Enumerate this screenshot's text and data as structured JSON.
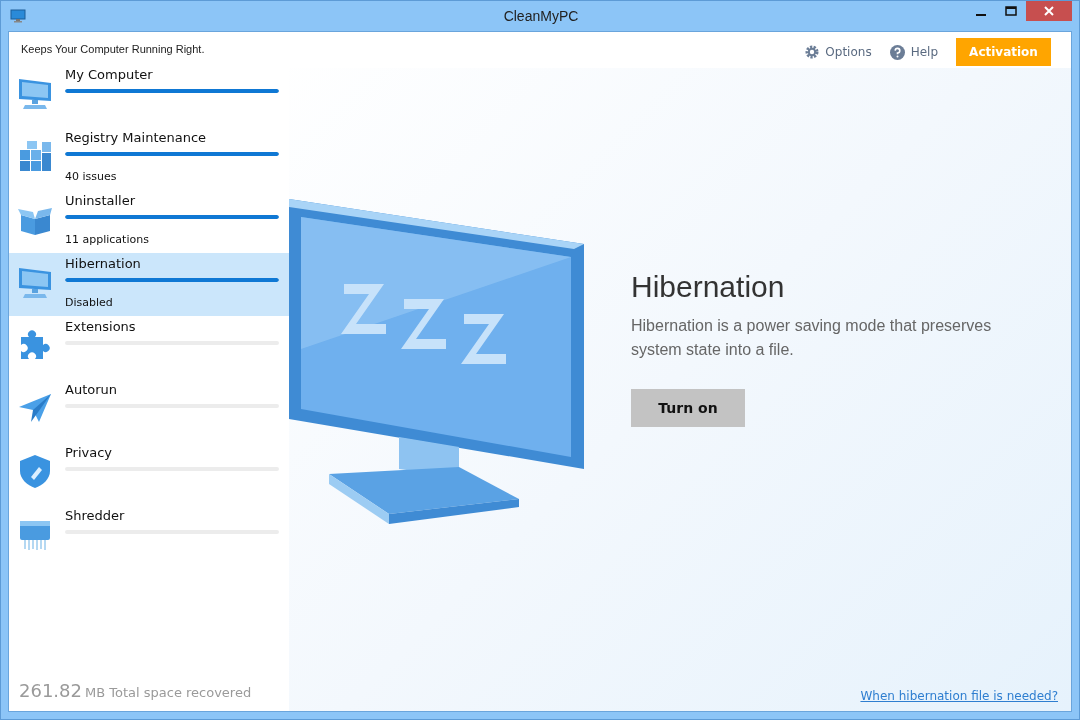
{
  "window": {
    "title": "CleanMyPC"
  },
  "tagline": "Keeps Your Computer Running Right.",
  "toolbar": {
    "options": "Options",
    "help": "Help",
    "activation": "Activation"
  },
  "sidebar": {
    "items": [
      {
        "label": "My Computer",
        "level": 1.0,
        "selected": false
      },
      {
        "label": "Registry Maintenance",
        "level": 1.0,
        "detail": "40 issues",
        "selected": false
      },
      {
        "label": "Uninstaller",
        "level": 1.0,
        "detail": "11 applications",
        "selected": false
      },
      {
        "label": "Hibernation",
        "level": 1.0,
        "detail": "Disabled",
        "selected": true
      },
      {
        "label": "Extensions",
        "level": 0,
        "selected": false
      },
      {
        "label": "Autorun",
        "level": 0,
        "selected": false
      },
      {
        "label": "Privacy",
        "level": 0,
        "selected": false
      },
      {
        "label": "Shredder",
        "level": 0,
        "selected": false
      }
    ],
    "total": {
      "amount": "261.82",
      "unit": "MB",
      "label": "Total space recovered"
    }
  },
  "main": {
    "heading": "Hibernation",
    "description": "Hibernation is a power saving mode that preserves system state into a file.",
    "button": "Turn on",
    "link": "When hibernation file is needed?"
  }
}
